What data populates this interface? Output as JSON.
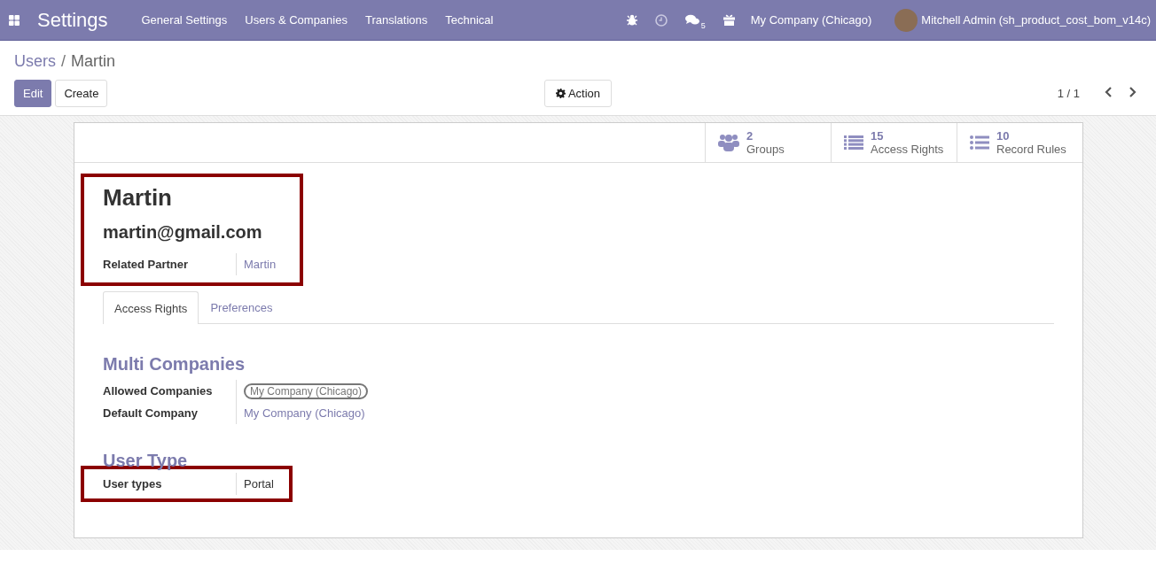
{
  "navbar": {
    "app_name": "Settings",
    "menus": [
      "General Settings",
      "Users & Companies",
      "Translations",
      "Technical"
    ],
    "messages_count": "5",
    "company": "My Company (Chicago)",
    "user": "Mitchell Admin (sh_product_cost_bom_v14c)"
  },
  "breadcrumb": {
    "parent": "Users",
    "separator": "/",
    "current": "Martin"
  },
  "buttons": {
    "edit": "Edit",
    "create": "Create",
    "action": "Action"
  },
  "pager": "1 / 1",
  "smart_buttons": [
    {
      "kind": "groups",
      "count": "2",
      "label": "Groups"
    },
    {
      "kind": "list",
      "count": "15",
      "label": "Access Rights"
    },
    {
      "kind": "bullets",
      "count": "10",
      "label": "Record Rules"
    }
  ],
  "header": {
    "highlighted": true,
    "name": "Martin",
    "email": "martin@gmail.com",
    "fields": [
      {
        "label": "Related Partner",
        "value": "Martin",
        "kind": "link"
      }
    ]
  },
  "tabs": [
    {
      "label": "Access Rights",
      "selected": true
    },
    {
      "label": "Preferences",
      "selected": false
    }
  ],
  "sections": [
    {
      "title": "Multi Companies",
      "highlighted": false,
      "fields": [
        {
          "label": "Allowed Companies",
          "value": "My Company (Chicago)",
          "kind": "tag"
        },
        {
          "label": "Default Company",
          "value": "My Company (Chicago)",
          "kind": "link"
        }
      ]
    },
    {
      "title": "User Type",
      "highlighted": true,
      "fields": [
        {
          "label": "User types",
          "value": "Portal",
          "kind": "text"
        }
      ]
    }
  ]
}
